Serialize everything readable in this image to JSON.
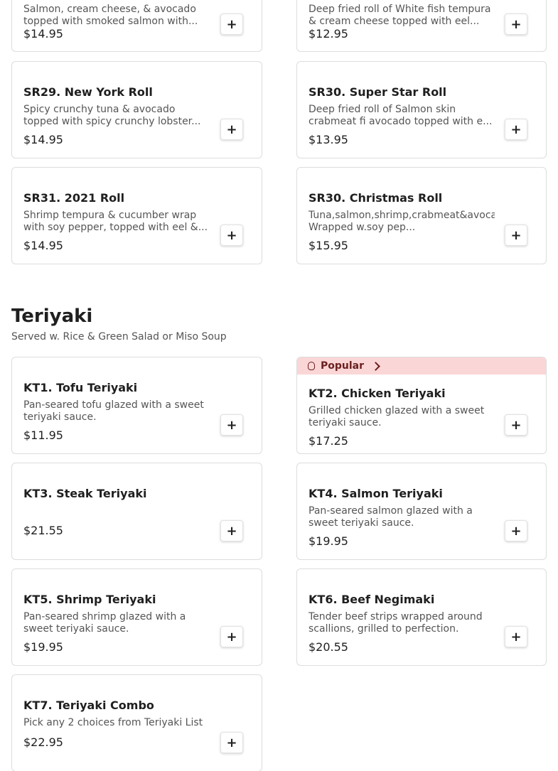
{
  "rolls": {
    "items": [
      {
        "title": "",
        "desc": "Salmon, cream cheese, & avocado topped with smoked salmon with...",
        "price": "$14.95"
      },
      {
        "title": "",
        "desc": "Deep fried roll of White fish tempura & cream cheese topped with eel...",
        "price": "$12.95"
      },
      {
        "title": "SR29. New York Roll",
        "desc": "Spicy crunchy tuna & avocado topped with spicy crunchy lobster...",
        "price": "$14.95"
      },
      {
        "title": "SR30. Super Star Roll",
        "desc": "Deep fried roll of Salmon skin crabmeat fi avocado topped with e...",
        "price": "$13.95"
      },
      {
        "title": "SR31. 2021 Roll",
        "desc": "Shrimp tempura & cucumber wrap with soy pepper, topped with eel &...",
        "price": "$14.95"
      },
      {
        "title": "SR30. Christmas Roll",
        "desc": "Tuna,salmon,shrimp,crabmeat&avocado,cucumber, Wrapped w.soy pep...",
        "price": "$15.95"
      }
    ]
  },
  "teriyaki": {
    "title": "Teriyaki",
    "subtitle": "Served w. Rice & Green Salad or Miso Soup",
    "popular_label": "Popular",
    "items": [
      {
        "title": "KT1. Tofu Teriyaki",
        "desc": "Pan-seared tofu glazed with a sweet teriyaki sauce.",
        "price": "$11.95"
      },
      {
        "title": "KT2. Chicken Teriyaki",
        "desc": "Grilled chicken glazed with a sweet teriyaki sauce.",
        "price": "$17.25",
        "popular": true
      },
      {
        "title": "KT3. Steak Teriyaki",
        "desc": "",
        "price": "$21.55"
      },
      {
        "title": "KT4. Salmon Teriyaki",
        "desc": "Pan-seared salmon glazed with a sweet teriyaki sauce.",
        "price": "$19.95"
      },
      {
        "title": "KT5. Shrimp Teriyaki",
        "desc": "Pan-seared shrimp glazed with a sweet teriyaki sauce.",
        "price": "$19.95"
      },
      {
        "title": "KT6. Beef Negimaki",
        "desc": "Tender beef strips wrapped around scallions, grilled to perfection.",
        "price": "$20.55"
      },
      {
        "title": "KT7. Teriyaki Combo",
        "desc": "Pick any 2 choices from Teriyaki List",
        "price": "$22.95"
      }
    ]
  },
  "add_button_label": "+",
  "colors": {
    "popular_bg": "#fbd6d6",
    "popular_text": "#6b1f1f",
    "border": "#dddddd"
  },
  "icons": {
    "popular": "flame-icon",
    "popular_arrow": "chevron-right-icon",
    "add": "plus-icon"
  }
}
